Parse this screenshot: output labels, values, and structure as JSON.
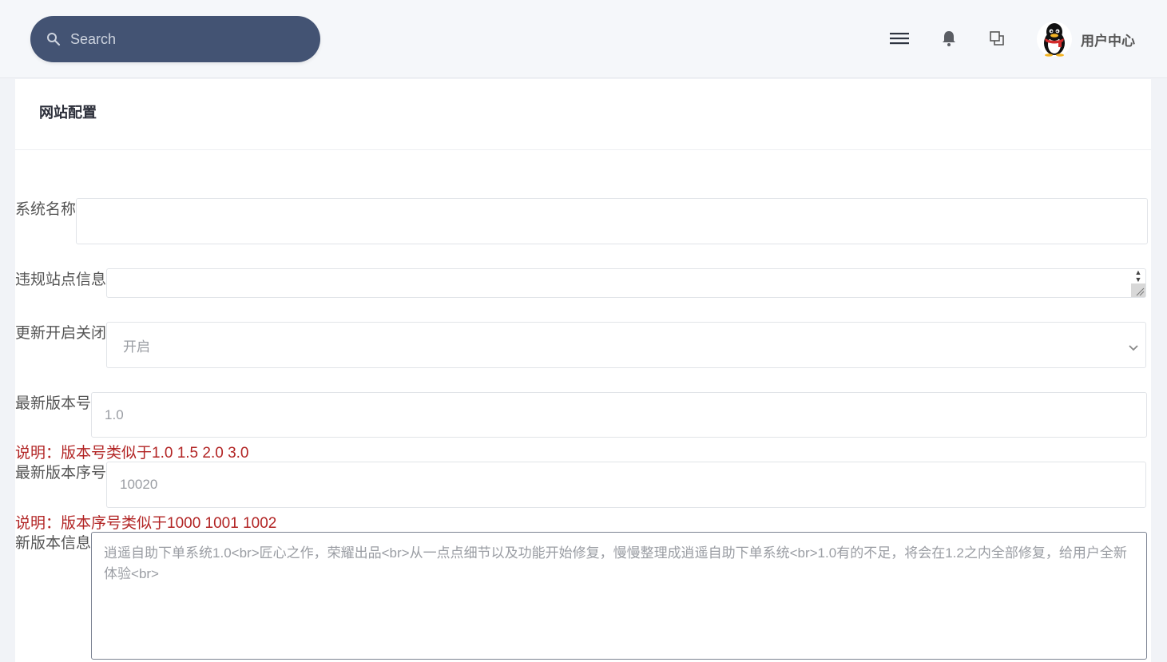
{
  "header": {
    "search_placeholder": "Search",
    "icons": [
      "menu-icon",
      "bell-icon",
      "window-icon"
    ],
    "user_center_label": "用户中心"
  },
  "card": {
    "title": "网站配置"
  },
  "form": {
    "system_name": {
      "label": "系统名称",
      "value": ""
    },
    "violation_info": {
      "label": "违规站点信息",
      "value": ""
    },
    "update_toggle": {
      "label": "更新开启关闭",
      "selected": "开启"
    },
    "latest_version": {
      "label": "最新版本号",
      "value": "1.0",
      "hint": "说明：版本号类似于1.0 1.5 2.0 3.0"
    },
    "latest_version_seq": {
      "label": "最新版本序号",
      "value": "10020",
      "hint": "说明：版本序号类似于1000 1001 1002"
    },
    "new_version_info": {
      "label": "新版本信息",
      "value": "逍遥自助下单系统1.0<br>匠心之作，荣耀出品<br>从一点点细节以及功能开始修复，慢慢整理成逍遥自助下单系统<br>1.0有的不足，将会在1.2之内全部修复，给用户全新体验<br>"
    }
  },
  "colors": {
    "search_bg": "#435373",
    "hint_red": "#b22424",
    "page_bg": "#f1f3f7"
  }
}
